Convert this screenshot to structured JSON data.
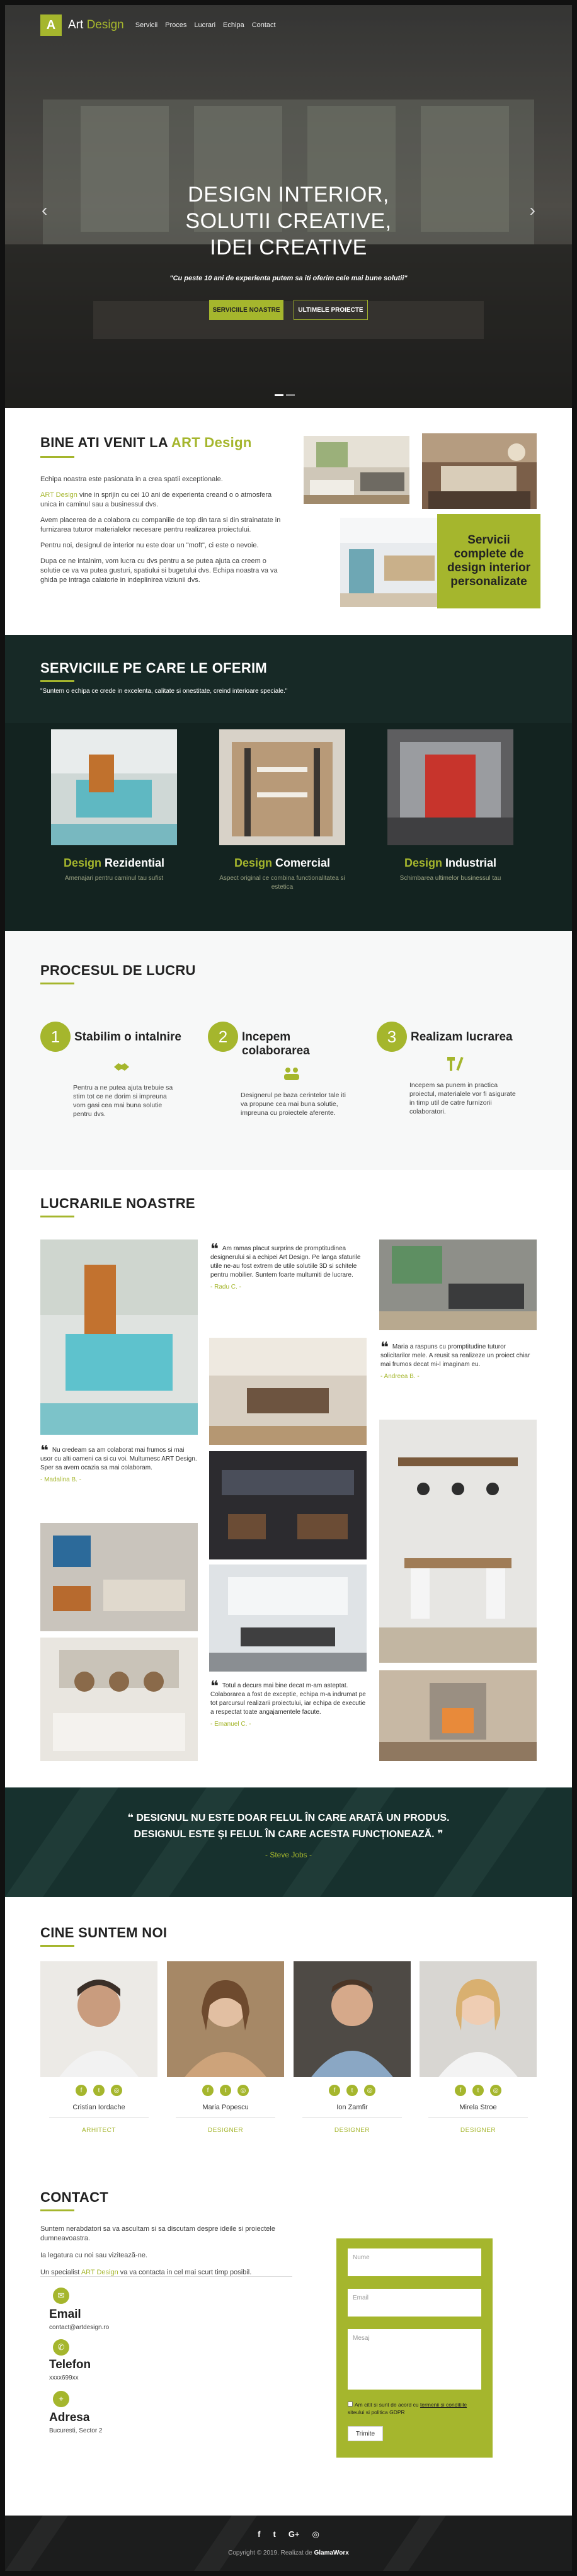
{
  "brand": {
    "logo_letter": "A",
    "name_part1": "Art",
    "name_part2": "Design",
    "accent": "#a5b62d"
  },
  "nav": {
    "items": [
      "Servicii",
      "Proces",
      "Lucrari",
      "Echipa",
      "Contact"
    ]
  },
  "hero": {
    "title_line1": "DESIGN INTERIOR,",
    "title_line2": "SOLUTII CREATIVE,",
    "title_line3": "IDEI CREATIVE",
    "subtitle": "\"Cu peste 10 ani de experienta putem sa iti oferim cele mai bune solutii\"",
    "btn_services": "SERVICIILE NOASTRE",
    "btn_projects": "ULTIMELE PROIECTE",
    "prev_icon": "chevron-left-icon",
    "next_icon": "chevron-right-icon"
  },
  "welcome": {
    "title_prefix": "BINE ATI VENIT LA ",
    "title_accent": "ART Design",
    "p1": "Echipa noastra este pasionata in a crea spatii exceptionale.",
    "p2_accent": "ART Design",
    "p2_rest": " vine in sprijin cu cei 10 ani de experienta creand o o atmosfera unica in caminul sau a businessul dvs.",
    "p3": "Avem placerea de a colabora cu companiile de top din tara si din strainatate in furnizarea tuturor materialelor necesare pentru realizarea proiectului.",
    "p4": "Pentru noi, designul de interior nu este doar un \"moft\", ci este o nevoie.",
    "p5": "Dupa ce ne intalnim, vom lucra cu dvs pentru a se putea ajuta ca creem o solutie ce va va putea gusturi, spatiului si bugetului dvs. Echipa noastra va va ghida pe intraga calatorie in indeplinirea viziunii dvs.",
    "box_text": "Servicii complete de design interior personalizate"
  },
  "services": {
    "title": "SERVICIILE PE CARE LE OFERIM",
    "subtitle": "\"Suntem o echipa ce crede in excelenta, calitate si onestitate, creind interioare speciale.\"",
    "cards": [
      {
        "accent": "Design",
        "name": " Rezidential",
        "desc": "Amenajari pentru caminul tau sufist"
      },
      {
        "accent": "Design",
        "name": " Comercial",
        "desc": "Aspect original ce combina functionalitatea si estetica"
      },
      {
        "accent": "Design",
        "name": " Industrial",
        "desc": "Schimbarea ultimelor businessul tau"
      }
    ]
  },
  "process": {
    "title": "PROCESUL DE LUCRU",
    "steps": [
      {
        "num": "1",
        "title": "Stabilim o intalnire",
        "text": "Pentru a ne putea ajuta trebuie sa stim tot ce ne dorim si impreuna vom gasi cea mai buna solutie pentru dvs."
      },
      {
        "num": "2",
        "title": "Incepem colaborarea",
        "text": "Designerul pe baza cerintelor tale iti va propune cea mai buna solutie, impreuna cu proiectele aferente."
      },
      {
        "num": "3",
        "title": "Realizam lucrarea",
        "text": "Incepem sa punem in practica proiectul, materialele vor fi asigurate in timp util de catre furnizorii colaboratori."
      }
    ]
  },
  "works": {
    "title": "LUCRARILE NOASTRE",
    "quote_mark": "❝",
    "testimonials": [
      {
        "text": "Am ramas placut surprins de promptitudinea designerului si a echipei Art Design. Pe langa sfaturile utile ne-au fost extrem de utile solutiile 3D si schitele pentru mobilier. Suntem foarte multumiti de lucrare.",
        "author": "- Radu C. -"
      },
      {
        "text": "Maria a raspuns cu promptitudine tuturor solicitarilor mele. A reusit sa realizeze un proiect chiar mai frumos decat mi-l imaginam eu.",
        "author": "- Andreea B. -"
      },
      {
        "text": "Nu credeam sa am colaborat mai frumos si mai usor cu alti oameni ca si cu voi. Multumesc ART Design. Sper sa avem ocazia sa mai colaboram.",
        "author": "- Madalina B. -"
      },
      {
        "text": "Totul a decurs mai bine decat m-am asteptat. Colaborarea a fost de exceptie, echipa m-a indrumat pe tot parcursul realizarii proiectului, iar echipa de executie a respectat toate angajamentele facute.",
        "author": "- Emanuel C. -"
      }
    ]
  },
  "banner": {
    "line1": "DESIGNUL NU ESTE DOAR FELUL ÎN CARE ARATĂ UN PRODUS.",
    "line2": "DESIGNUL ESTE ȘI FELUL ÎN CARE ACESTA FUNCȚIONEAZĂ.",
    "author": "- Steve Jobs -",
    "open_quote": "❝",
    "close_quote": "❞"
  },
  "team": {
    "title": "CINE SUNTEM NOI",
    "members": [
      {
        "name": "Cristian Iordache",
        "role": "ARHITECT"
      },
      {
        "name": "Maria Popescu",
        "role": "DESIGNER"
      },
      {
        "name": "Ion Zamfir",
        "role": "DESIGNER"
      },
      {
        "name": "Mirela Stroe",
        "role": "DESIGNER"
      }
    ],
    "social_icons": [
      "f",
      "t",
      "◎"
    ]
  },
  "contact": {
    "title": "CONTACT",
    "p1": "Suntem nerabdatori sa va ascultam si sa discutam despre ideile si proiectele dumneavoastra.",
    "p2": "Ia legatura cu noi sau vizitează-ne.",
    "p3_prefix": "Un specialist ",
    "p3_accent": "ART Design",
    "p3_rest": " va va contacta in cel mai scurt timp posibil.",
    "email_label": "Email",
    "email_value": "contact@artdesign.ro",
    "phone_label": "Telefon",
    "phone_value": "xxxx699xx",
    "address_label": "Adresa",
    "address_value": "Bucuresti, Sector 2",
    "form": {
      "name_placeholder": "Nume",
      "email_placeholder": "Email",
      "message_placeholder": "Mesaj",
      "terms_prefix": "Am citit si sunt de acord cu ",
      "terms_link": "termenii si conditiile",
      "terms_rest": " siteului si politica GDPR",
      "submit": "Trimite"
    }
  },
  "footer": {
    "copyright": "Copyright © 2019. Realizat de",
    "maker": "GlamaWorx",
    "icons": [
      "f",
      "t",
      "G+",
      "◎"
    ]
  }
}
